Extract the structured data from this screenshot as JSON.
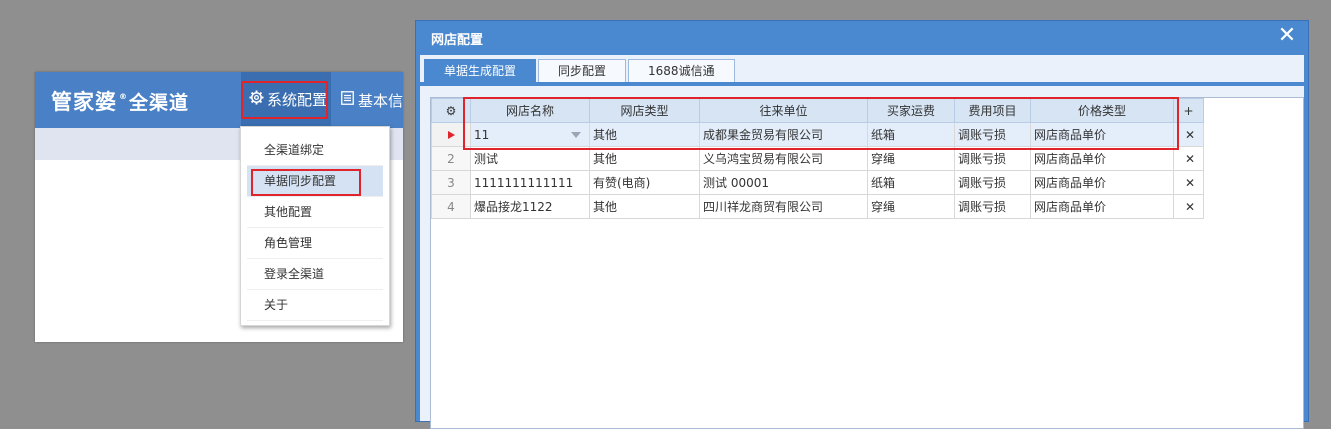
{
  "app": {
    "logo_main": "管家婆",
    "logo_reg": "®",
    "logo_sub": "全渠道",
    "nav_system": "系统配置",
    "nav_basic": "基本信"
  },
  "dropdown": {
    "items": [
      "全渠道绑定",
      "单据同步配置",
      "其他配置",
      "角色管理",
      "登录全渠道",
      "关于"
    ]
  },
  "dialog": {
    "title": "网店配置",
    "close": "✕",
    "tabs": [
      "单据生成配置",
      "同步配置",
      "1688诚信通"
    ],
    "columns": [
      "网店名称",
      "网店类型",
      "往来单位",
      "买家运费",
      "费用项目",
      "价格类型"
    ],
    "add_icon": "+",
    "gear_icon": "⚙",
    "rows": [
      {
        "num": "",
        "shop": "11",
        "type": "其他",
        "partner": "成都果金贸易有限公司",
        "freight": "纸箱",
        "fee": "调账亏损",
        "price": "网店商品单价"
      },
      {
        "num": "2",
        "shop": "测试",
        "type": "其他",
        "partner": "义乌鸿宝贸易有限公司",
        "freight": "穿绳",
        "fee": "调账亏损",
        "price": "网店商品单价"
      },
      {
        "num": "3",
        "shop": "1111111111111",
        "type": "有赞(电商)",
        "partner": "测试 00001",
        "freight": "纸箱",
        "fee": "调账亏损",
        "price": "网店商品单价"
      },
      {
        "num": "4",
        "shop": "爆品接龙1122",
        "type": "其他",
        "partner": "四川祥龙商贸有限公司",
        "freight": "穿绳",
        "fee": "调账亏损",
        "price": "网店商品单价"
      }
    ],
    "delete_icon": "✕"
  },
  "colors": {
    "header_blue": "#4a80c5",
    "dialog_blue": "#4a88d0",
    "highlight_red": "#e0242b",
    "add_green": "#2aa52a"
  }
}
